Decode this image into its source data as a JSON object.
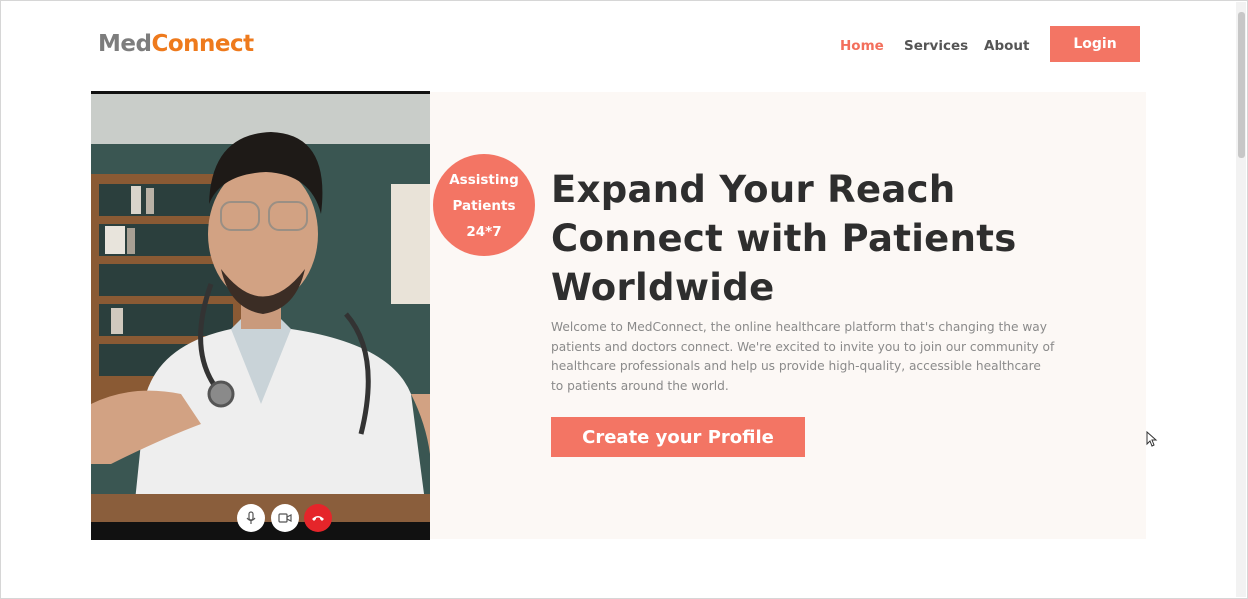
{
  "brand": {
    "part1": "Med",
    "part2": "Connect"
  },
  "nav": {
    "items": [
      {
        "label": "Home",
        "active": true
      },
      {
        "label": "Services",
        "active": false
      },
      {
        "label": "About",
        "active": false
      }
    ],
    "login_label": "Login"
  },
  "hero": {
    "badge": {
      "line1": "Assisting",
      "line2": "Patients",
      "line3": "24*7"
    },
    "headline": {
      "line1": "Expand Your Reach",
      "line2": "Connect with Patients",
      "line3": "Worldwide"
    },
    "paragraph": {
      "line1": "Welcome to MedConnect, the online healthcare platform that's changing the way",
      "line2": "patients and doctors connect. We're excited to invite you to join our community of",
      "line3": "healthcare professionals and help us provide high-quality, accessible healthcare",
      "line4": "to patients around the world."
    },
    "cta_label": "Create your Profile",
    "video_controls": [
      "microphone-icon",
      "video-camera-icon",
      "hang-up-icon"
    ]
  },
  "colors": {
    "accent": "#f37564",
    "brand_orange": "#ee7a1d",
    "brand_gray": "#7d7d7d",
    "hero_background": "#fcf8f5",
    "heading": "#2e2e2e"
  }
}
